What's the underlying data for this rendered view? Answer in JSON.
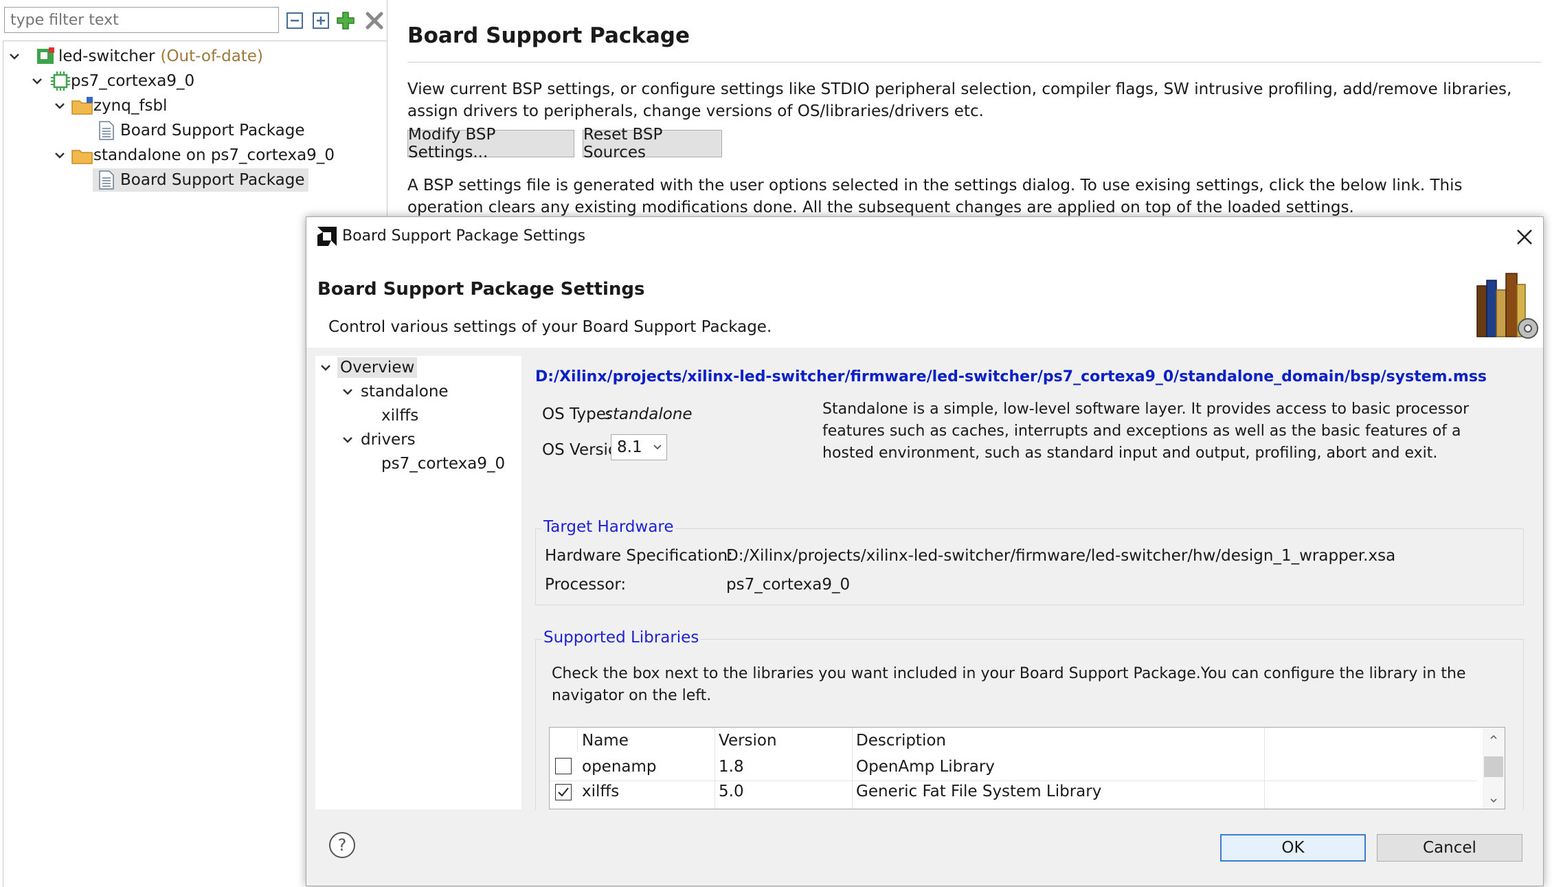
{
  "explorer": {
    "filter_placeholder": "type filter text",
    "tree": {
      "project": "led-switcher",
      "project_status": "(Out-of-date)",
      "processor": "ps7_cortexa9_0",
      "fsbl": "zynq_fsbl",
      "fsbl_bsp": "Board Support Package",
      "standalone": "standalone on ps7_cortexa9_0",
      "standalone_bsp": "Board Support Package"
    }
  },
  "editor": {
    "title": "Board Support Package",
    "description": "View current BSP settings, or configure settings like STDIO peripheral selection, compiler flags, SW intrusive profiling, add/remove libraries, assign drivers to peripherals, change versions of OS/libraries/drivers etc.",
    "modify_button": "Modify BSP Settings...",
    "reset_button": "Reset BSP Sources",
    "settings_note": "A BSP settings file is generated with the user options selected in the settings dialog. To use exising settings, click the below link. This operation clears any existing modifications done. All the subsequent changes are applied on top of the loaded settings."
  },
  "dialog": {
    "window_title": "Board Support Package Settings",
    "heading": "Board Support Package Settings",
    "subheading": "Control various settings of your Board Support Package.",
    "nav": {
      "overview": "Overview",
      "standalone": "standalone",
      "xilffs": "xilffs",
      "drivers": "drivers",
      "driver_proc": "ps7_cortexa9_0"
    },
    "mss_path": "D:/Xilinx/projects/xilinx-led-switcher/firmware/led-switcher/ps7_cortexa9_0/standalone_domain/bsp/system.mss",
    "os_type_label": "OS Type:",
    "os_type_value": "standalone",
    "os_version_label": "OS Version:",
    "os_version_value": "8.1",
    "os_description": "Standalone is a simple, low-level software layer. It provides access to basic processor features such as caches, interrupts and exceptions as well as the basic features of a hosted environment, such as standard input and output, profiling, abort and exit.",
    "target_hardware": {
      "title": "Target Hardware",
      "hw_spec_label": "Hardware Specification:",
      "hw_spec_value": "D:/Xilinx/projects/xilinx-led-switcher/firmware/led-switcher/hw/design_1_wrapper.xsa",
      "processor_label": "Processor:",
      "processor_value": "ps7_cortexa9_0"
    },
    "libraries": {
      "title": "Supported Libraries",
      "instructions": "Check the box next to the libraries you want included in your Board Support Package.You can configure the library in the navigator on the left.",
      "columns": [
        "Name",
        "Version",
        "Description"
      ],
      "rows": [
        {
          "name": "openamp",
          "version": "1.8",
          "description": "OpenAmp Library",
          "checked": false
        },
        {
          "name": "xilffs",
          "version": "5.0",
          "description": "Generic Fat File System Library",
          "checked": true
        }
      ]
    },
    "ok_button": "OK",
    "cancel_button": "Cancel"
  },
  "colors": {
    "project_icon": "#3ea34a",
    "folder": "#f2b84b",
    "link": "#0b21c6",
    "group_title": "#1e22d6",
    "out_of_date": "#9c7a3c"
  }
}
